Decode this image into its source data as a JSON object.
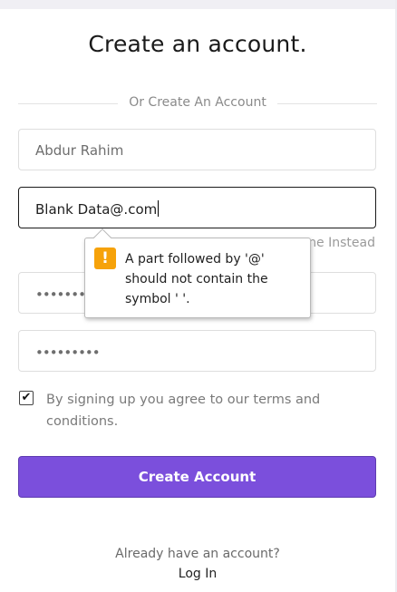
{
  "title": "Create an account.",
  "divider_text": "Or Create An Account",
  "fields": {
    "name_value": "Abdur Rahim",
    "email_value": "Blank Data@.com",
    "password_value": "••••••••••",
    "confirm_value": "•••••••••"
  },
  "hidden_hint": "ne Instead",
  "tooltip": {
    "icon": "warning-icon",
    "message": "A part followed by '@' should not contain the symbol ' '."
  },
  "terms": {
    "checked": true,
    "label": "By signing up you agree to our terms and conditions."
  },
  "create_button": "Create Account",
  "footer": {
    "already": "Already have an account?",
    "login": "Log In"
  },
  "colors": {
    "accent": "#7b4fdc",
    "warning": "#f6a20a"
  }
}
